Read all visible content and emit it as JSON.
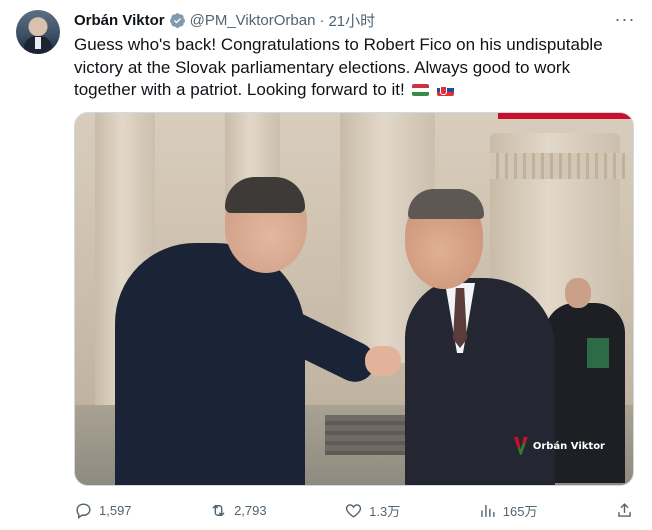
{
  "tweet": {
    "author_name": "Orbán Viktor",
    "handle": "@PM_ViktorOrban",
    "separator": "·",
    "time": "21小时",
    "verified_icon": "verified-badge-icon",
    "more_label": "···",
    "text": "Guess who's back! Congratulations to Robert Fico on his undisputable victory at the Slovak parliamentary elections. Always good to work together with a patriot. Looking forward to it!",
    "flags": [
      "flag-hungary-icon",
      "flag-slovakia-icon"
    ]
  },
  "media": {
    "watermark": "Orbán Viktor"
  },
  "actions": {
    "replies": "1,597",
    "retweets": "2,793",
    "likes": "1.3万",
    "views": "165万"
  },
  "colors": {
    "text": "#0f1419",
    "secondary": "#536471",
    "verified": "#829aab",
    "brand_red": "#c8102e"
  }
}
